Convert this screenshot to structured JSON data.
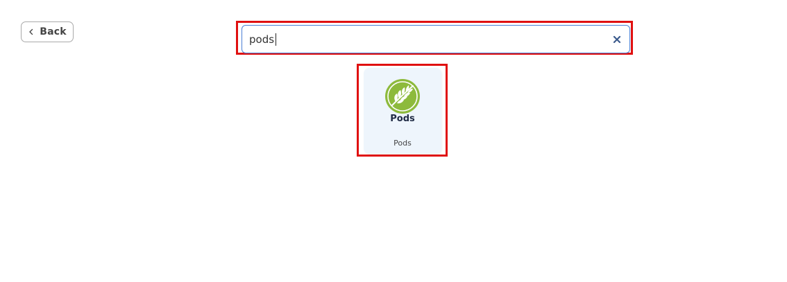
{
  "back_button": {
    "label": "Back",
    "icon": "chevron-left-icon"
  },
  "search": {
    "value": "pods",
    "clear_icon": "close-icon"
  },
  "results": [
    {
      "logo_title": "Pods",
      "name": "Pods",
      "logo_icon": "pods-leaf-logo",
      "logo_color": "#8dba3c"
    }
  ],
  "colors": {
    "highlight": "#e01010",
    "search_border": "#4a7fd4",
    "card_background": "#eef5fc"
  }
}
